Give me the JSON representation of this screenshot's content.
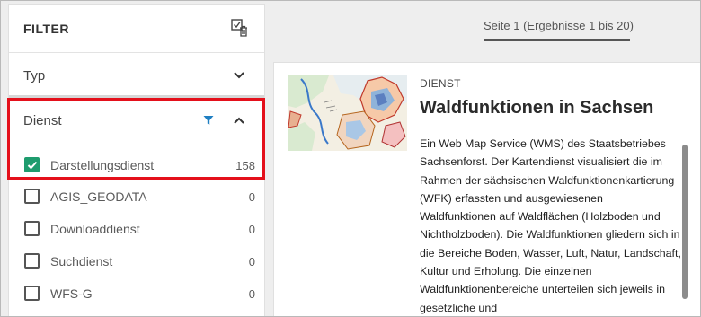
{
  "filter": {
    "title": "FILTER",
    "reset_icon": "filter-reset-icon",
    "sections": {
      "typ": {
        "label": "Typ",
        "expanded": false
      },
      "dienst": {
        "label": "Dienst",
        "expanded": true,
        "active_filter_icon": "funnel-icon",
        "options": [
          {
            "label": "Darstellungsdienst",
            "count": "158",
            "checked": true
          },
          {
            "label": "AGIS_GEODATA",
            "count": "0",
            "checked": false
          },
          {
            "label": "Downloaddienst",
            "count": "0",
            "checked": false
          },
          {
            "label": "Suchdienst",
            "count": "0",
            "checked": false
          },
          {
            "label": "WFS-G",
            "count": "0",
            "checked": false
          }
        ]
      }
    }
  },
  "pager": {
    "label": "Seite 1 (Ergebnisse 1 bis 20)",
    "progress_fraction": 1.0
  },
  "result": {
    "type": "DIENST",
    "title": "Waldfunktionen in Sachsen",
    "description": "Ein Web Map Service (WMS) des Staatsbetriebes Sachsenforst. Der Kartendienst visualisiert die im Rahmen der sächsischen Waldfunktionenkartierung (WFK) erfassten und ausgewiesenen Waldfunktionen auf Waldflächen (Holzboden und Nichtholzboden). Die Waldfunktionen gliedern sich in die Bereiche Boden, Wasser, Luft, Natur, Landschaft, Kultur und Erholung. Die einzelnen Waldfunktionenbereiche unterteilen sich jeweils in gesetzliche und",
    "thumbnail": "map-thumbnail"
  },
  "colors": {
    "checkbox_checked": "#1e9c6e",
    "highlight_border": "#e4101b",
    "funnel": "#1f7fc2"
  }
}
